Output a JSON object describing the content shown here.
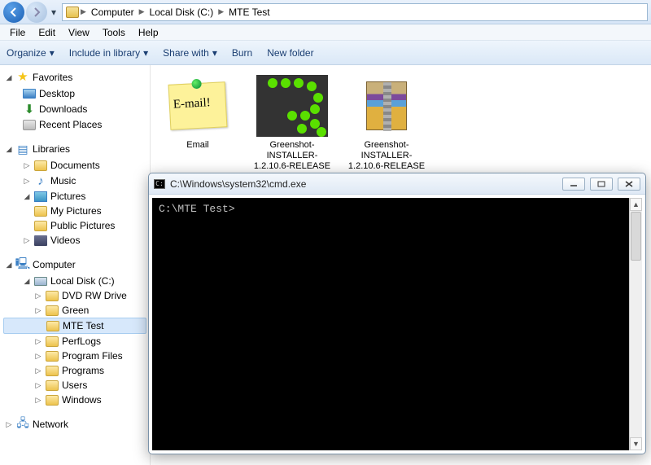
{
  "breadcrumb": {
    "root_icon": "folder",
    "items": [
      "Computer",
      "Local Disk (C:)",
      "MTE Test"
    ]
  },
  "menu": {
    "file": "File",
    "edit": "Edit",
    "view": "View",
    "tools": "Tools",
    "help": "Help"
  },
  "toolbar": {
    "organize": "Organize",
    "include": "Include in library",
    "share": "Share with",
    "burn": "Burn",
    "newfolder": "New folder"
  },
  "nav": {
    "favorites": {
      "label": "Favorites",
      "items": {
        "desktop": "Desktop",
        "downloads": "Downloads",
        "recent": "Recent Places"
      }
    },
    "libraries": {
      "label": "Libraries",
      "items": {
        "documents": "Documents",
        "music": "Music",
        "pictures": "Pictures",
        "mypics": "My Pictures",
        "pubpics": "Public Pictures",
        "videos": "Videos"
      }
    },
    "computer": {
      "label": "Computer",
      "disk": "Local Disk (C:)",
      "folders": {
        "dvd": "DVD RW Drive",
        "green": "Green",
        "mte": "MTE Test",
        "perf": "PerfLogs",
        "pf": "Program Files",
        "programs": "Programs",
        "users": "Users",
        "windows": "Windows"
      }
    },
    "network": {
      "label": "Network"
    }
  },
  "files": {
    "email": {
      "name": "Email",
      "note": "E-mail!"
    },
    "gs1": {
      "name": "Greenshot-INSTALLER-1.2.10.6-RELEASE"
    },
    "gs2": {
      "name": "Greenshot-INSTALLER-1.2.10.6-RELEASE"
    }
  },
  "cmd": {
    "title": "C:\\Windows\\system32\\cmd.exe",
    "prompt": "C:\\MTE Test>"
  }
}
